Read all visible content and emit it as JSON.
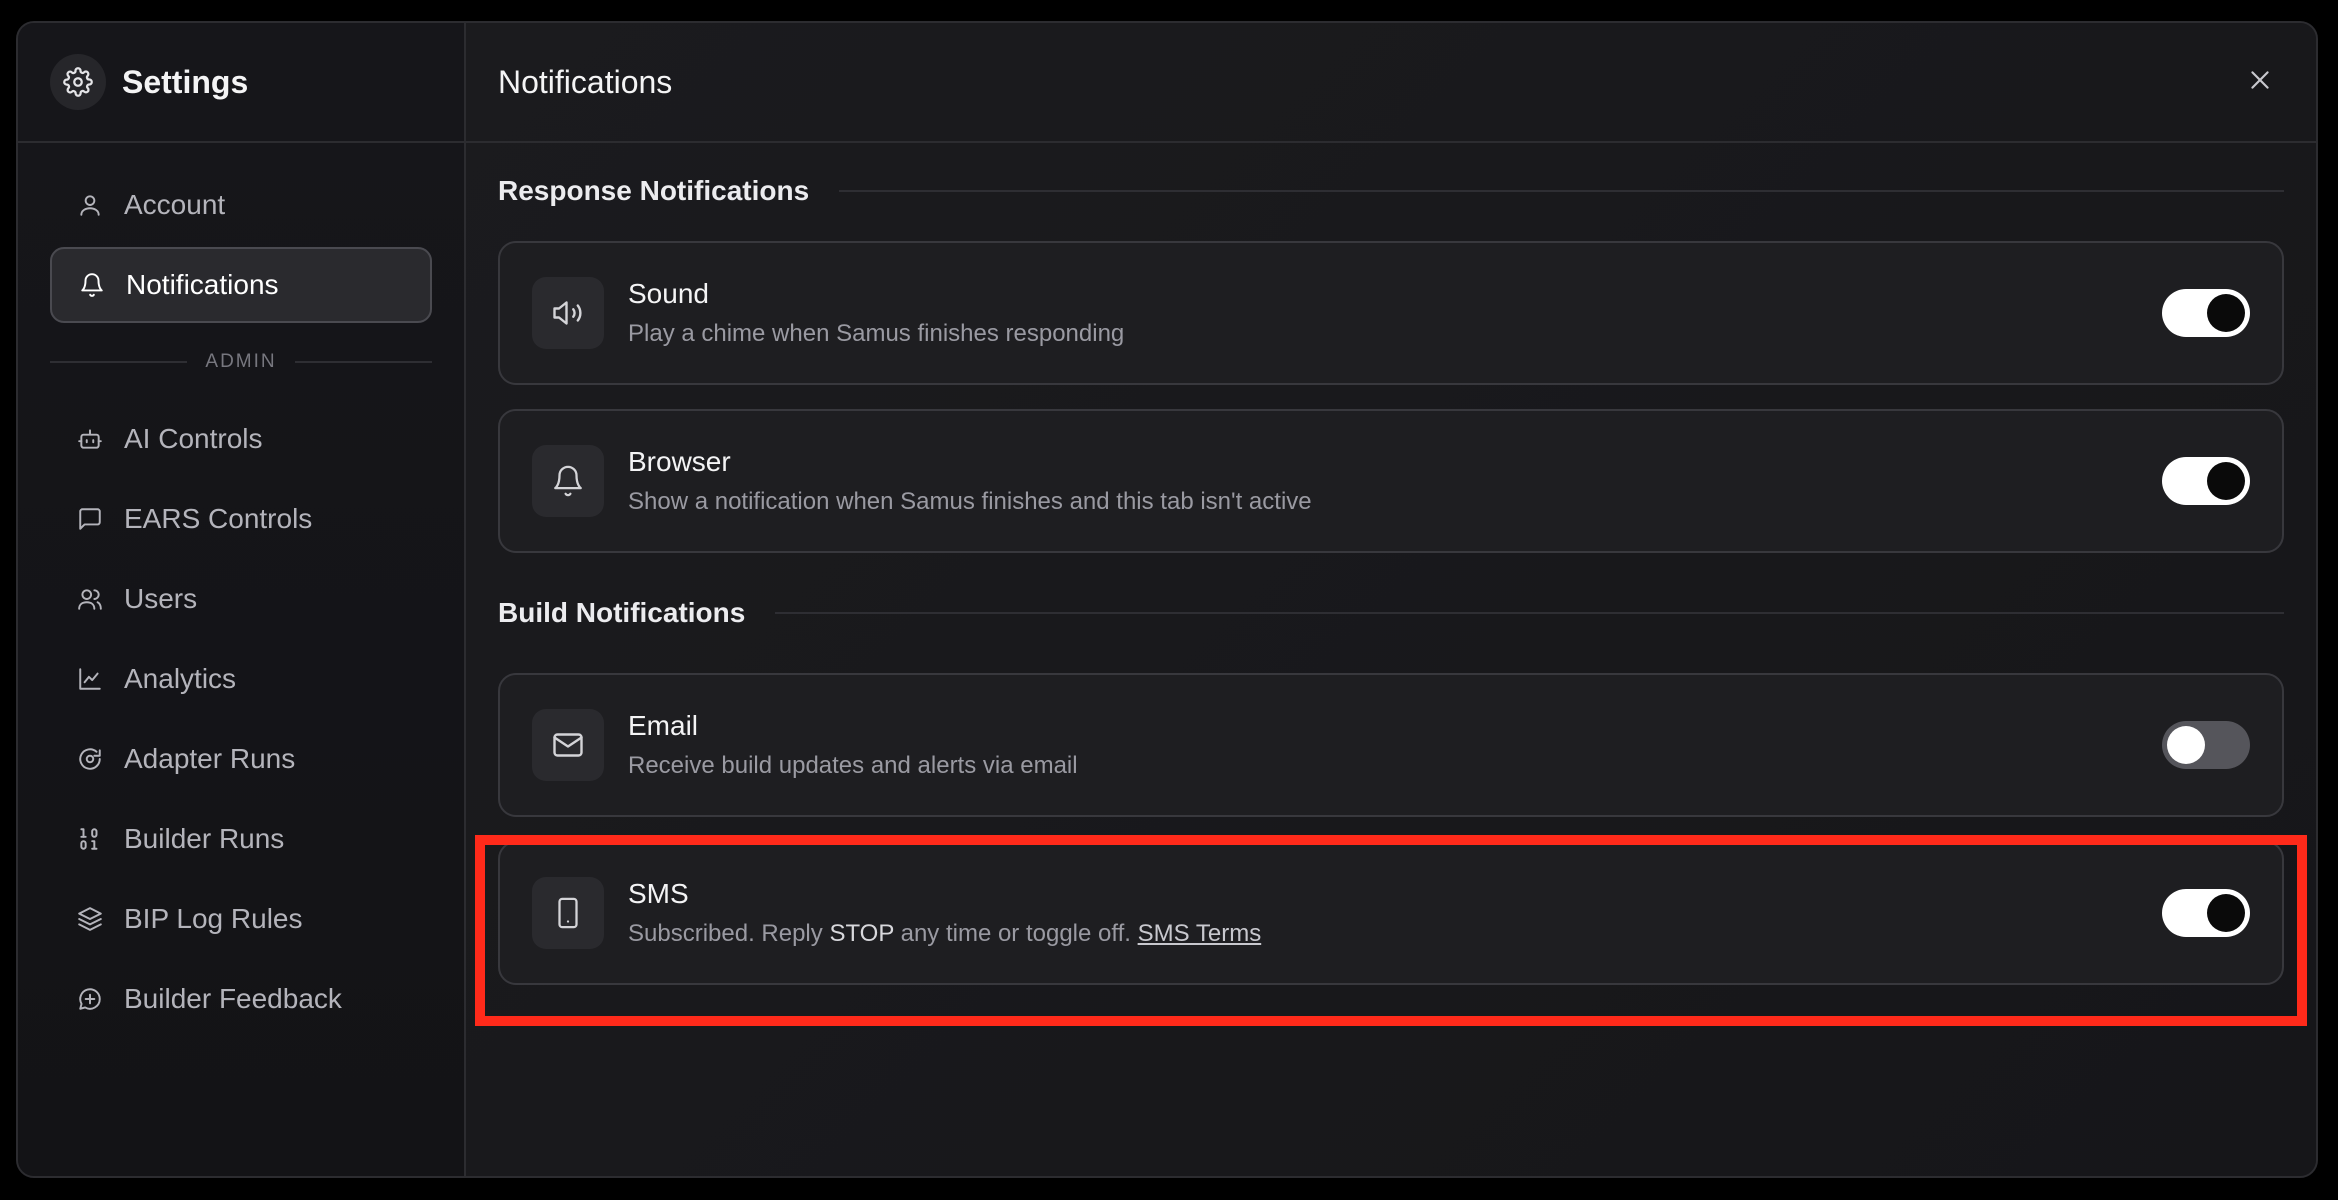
{
  "sidebar": {
    "title": "Settings",
    "items": [
      {
        "label": "Account",
        "icon": "user-icon"
      },
      {
        "label": "Notifications",
        "icon": "bell-icon",
        "active": true
      }
    ],
    "admin_label": "ADMIN",
    "admin_items": [
      {
        "label": "AI Controls",
        "icon": "bot-icon"
      },
      {
        "label": "EARS Controls",
        "icon": "message-square-icon"
      },
      {
        "label": "Users",
        "icon": "users-icon"
      },
      {
        "label": "Analytics",
        "icon": "line-chart-icon"
      },
      {
        "label": "Adapter Runs",
        "icon": "refresh-cycle-icon"
      },
      {
        "label": "Builder Runs",
        "icon": "binary-icon"
      },
      {
        "label": "BIP Log Rules",
        "icon": "layers-icon"
      },
      {
        "label": "Builder Feedback",
        "icon": "message-plus-icon"
      }
    ]
  },
  "main": {
    "title": "Notifications",
    "groups": [
      {
        "title": "Response Notifications",
        "items": [
          {
            "title": "Sound",
            "desc": "Play a chime when Samus finishes responding",
            "icon": "speaker-icon",
            "enabled": true
          },
          {
            "title": "Browser",
            "desc": "Show a notification when Samus finishes and this tab isn't active",
            "icon": "bell-icon",
            "enabled": true
          }
        ]
      },
      {
        "title": "Build Notifications",
        "items": [
          {
            "title": "Email",
            "desc": "Receive build updates and alerts via email",
            "icon": "mail-icon",
            "enabled": false
          },
          {
            "title": "SMS",
            "desc_prefix": "Subscribed. Reply ",
            "desc_strong": "STOP",
            "desc_suffix": " any time or toggle off. ",
            "desc_link": "SMS Terms",
            "icon": "smartphone-icon",
            "enabled": true
          }
        ]
      }
    ]
  },
  "colors": {
    "highlight": "#ff2a1a",
    "background": "#18181b",
    "toggle_on": "#ffffff"
  }
}
